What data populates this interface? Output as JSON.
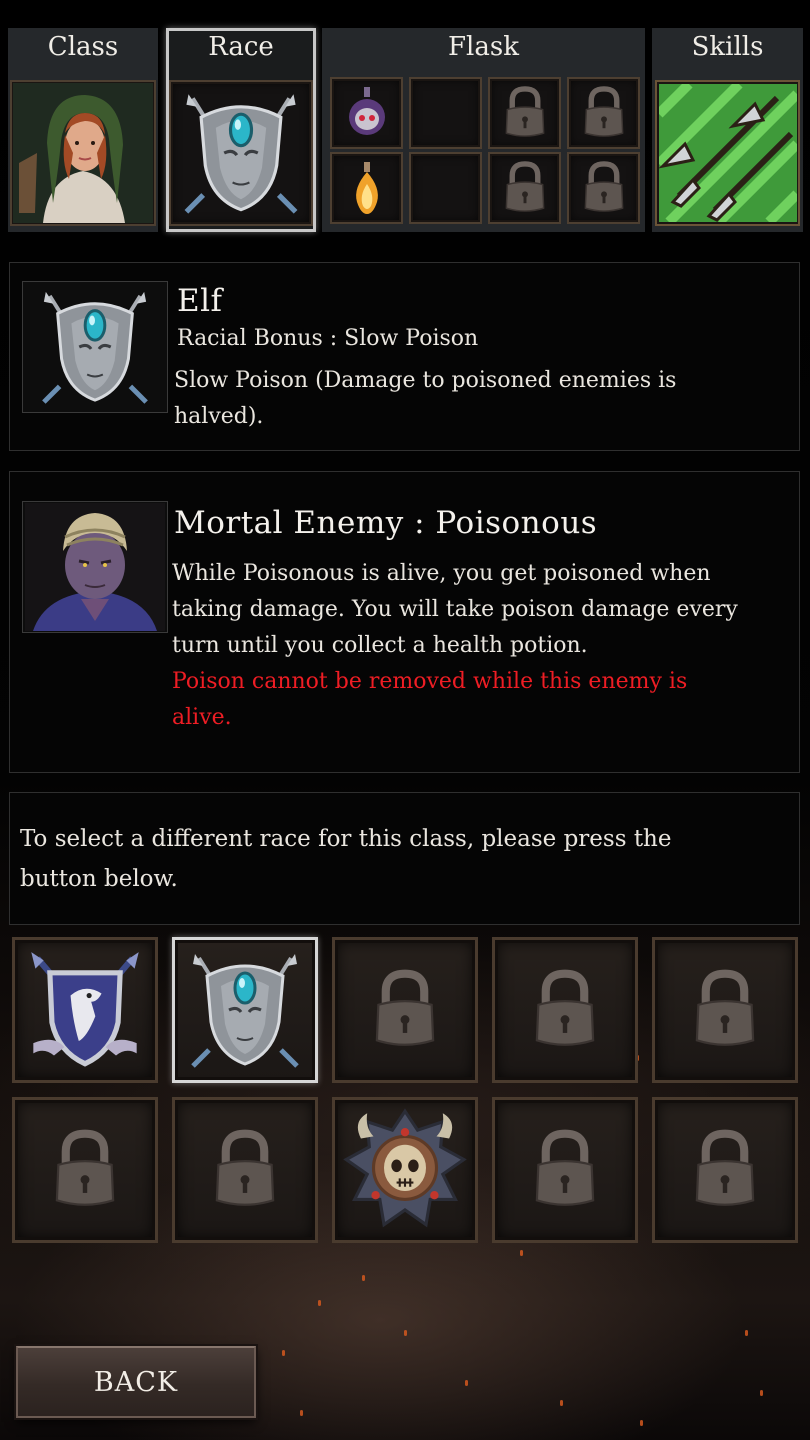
{
  "tabs": {
    "class": "Class",
    "race": "Race",
    "flask": "Flask",
    "skills": "Skills"
  },
  "flask_slots": [
    "potion-skull-icon",
    "empty",
    "lock-icon",
    "lock-icon",
    "potion-fire-icon",
    "empty",
    "lock-icon",
    "lock-icon"
  ],
  "race_info": {
    "name": "Elf",
    "bonus": "Racial Bonus : Slow Poison",
    "description_line1": "Slow Poison (Damage to poisoned enemies is",
    "description_line2": "halved)."
  },
  "enemy_info": {
    "title": "Mortal Enemy : Poisonous",
    "line1": "While Poisonous is alive, you get poisoned when",
    "line2": "taking damage. You will take poison damage every",
    "line3": "turn until you collect a health potion.",
    "warn_line1": "Poison cannot be removed while this enemy is",
    "warn_line2": "alive."
  },
  "instructions": {
    "line1": "To select a different race for this class, please press the",
    "line2": "button below."
  },
  "races": [
    {
      "icon": "eagle-shield-icon",
      "selected": false,
      "locked": false
    },
    {
      "icon": "elf-mask-icon",
      "selected": true,
      "locked": false
    },
    {
      "icon": "lock-icon",
      "selected": false,
      "locked": true
    },
    {
      "icon": "lock-icon",
      "selected": false,
      "locked": true
    },
    {
      "icon": "lock-icon",
      "selected": false,
      "locked": true
    },
    {
      "icon": "lock-icon",
      "selected": false,
      "locked": true
    },
    {
      "icon": "lock-icon",
      "selected": false,
      "locked": true
    },
    {
      "icon": "orc-skull-icon",
      "selected": false,
      "locked": false
    },
    {
      "icon": "lock-icon",
      "selected": false,
      "locked": true
    },
    {
      "icon": "lock-icon",
      "selected": false,
      "locked": true
    }
  ],
  "back_button": "BACK",
  "colors": {
    "warning": "#ee1d24",
    "selected_border": "#d6d6d6",
    "slot_border": "#4a3b2e"
  }
}
